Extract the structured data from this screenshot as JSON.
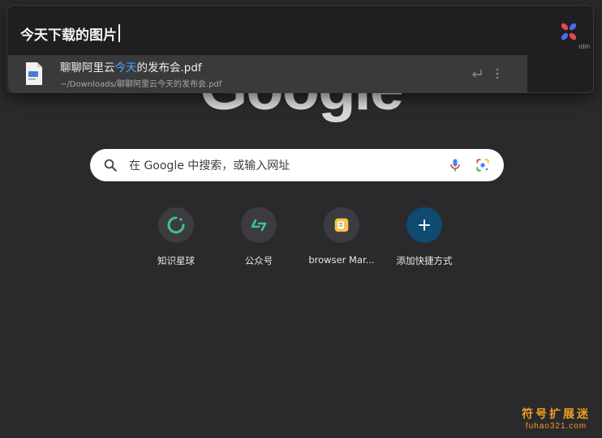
{
  "newtab": {
    "logo_text": "Google",
    "search": {
      "placeholder": "在 Google 中搜索，或输入网址",
      "icons": [
        "search-icon",
        "microphone-icon",
        "google-lens-icon"
      ]
    },
    "shortcuts": [
      {
        "label": "知识星球",
        "icon": "zsxq-ring-icon",
        "color": "#3fc58c"
      },
      {
        "label": "公众号",
        "icon": "wechat-mp-icon",
        "color": "#3fc58c"
      },
      {
        "label": "browser Mar...",
        "icon": "browser-marks-icon",
        "color": "#f6c547"
      },
      {
        "label": "添加快捷方式",
        "icon": "plus-icon",
        "color": "#0f4a70"
      }
    ]
  },
  "palette": {
    "query": "今天下载的图片",
    "brand": "rdm",
    "results": [
      {
        "title_pre": "聊聊阿里云",
        "title_highlight": "今天",
        "title_post": "的发布会.pdf",
        "path": "~/Downloads/聊聊阿里云今天的发布会.pdf",
        "icon": "pdf-file-icon"
      }
    ],
    "highlight_color": "#4fa8ff"
  },
  "watermark": {
    "main": "符号扩展迷",
    "sub": "fuhao321.com"
  }
}
